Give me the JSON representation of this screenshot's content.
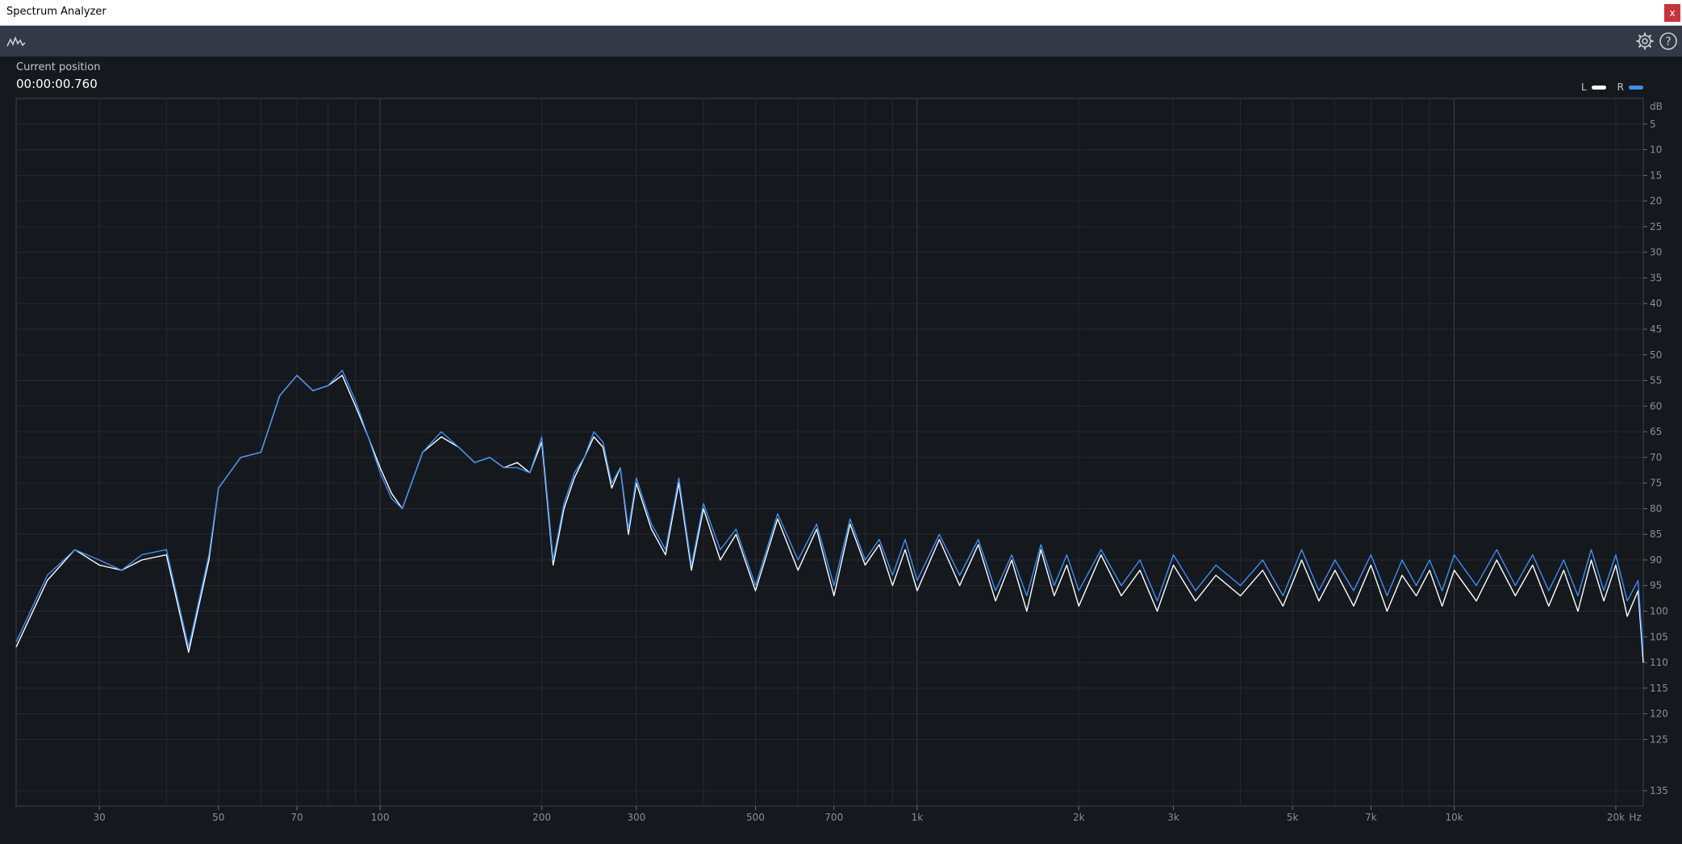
{
  "window": {
    "title": "Spectrum Analyzer",
    "close_label": "x"
  },
  "toolbar": {
    "left_icon": "waveform-icon",
    "gear_icon": "gear-icon",
    "help_icon": "help-icon"
  },
  "status": {
    "position_label": "Current position",
    "position_value": "00:00:00.760"
  },
  "colors": {
    "background": "#15181d",
    "toolbar": "#343a45",
    "grid": "#262b33",
    "major_grid": "#3a3f48",
    "left": "#ffffff",
    "right": "#3e8ef0"
  },
  "chart_data": {
    "type": "line",
    "title": "",
    "xlabel": "Hz",
    "ylabel": "dB",
    "x_scale": "log",
    "xlim": [
      21,
      22500
    ],
    "ylim": [
      0,
      -138
    ],
    "x_ticks": [
      30,
      50,
      70,
      100,
      200,
      300,
      500,
      700,
      1000,
      2000,
      3000,
      5000,
      7000,
      10000,
      20000
    ],
    "x_tick_labels": [
      "30",
      "50",
      "70",
      "100",
      "200",
      "300",
      "500",
      "700",
      "1k",
      "2k",
      "3k",
      "5k",
      "7k",
      "10k",
      "20k"
    ],
    "y_ticks": [
      -5,
      -10,
      -15,
      -20,
      -25,
      -30,
      -35,
      -40,
      -45,
      -50,
      -55,
      -60,
      -65,
      -70,
      -75,
      -80,
      -85,
      -90,
      -95,
      -100,
      -105,
      -110,
      -115,
      -120,
      -125,
      -135
    ],
    "y_tick_labels": [
      "5",
      "10",
      "15",
      "20",
      "25",
      "30",
      "35",
      "40",
      "45",
      "50",
      "55",
      "60",
      "65",
      "70",
      "75",
      "80",
      "85",
      "90",
      "95",
      "100",
      "105",
      "110",
      "115",
      "120",
      "125",
      "135"
    ],
    "grid": true,
    "legend_position": "top-right",
    "series": [
      {
        "name": "L",
        "color": "#ffffff",
        "x": [
          21,
          24,
          27,
          30,
          33,
          36,
          40,
          44,
          48,
          50,
          55,
          60,
          65,
          70,
          75,
          80,
          85,
          90,
          95,
          100,
          105,
          110,
          120,
          130,
          140,
          150,
          160,
          170,
          180,
          190,
          200,
          210,
          220,
          230,
          240,
          250,
          260,
          270,
          280,
          290,
          300,
          320,
          340,
          360,
          380,
          400,
          430,
          460,
          500,
          550,
          600,
          650,
          700,
          750,
          800,
          850,
          900,
          950,
          1000,
          1100,
          1200,
          1300,
          1400,
          1500,
          1600,
          1700,
          1800,
          1900,
          2000,
          2200,
          2400,
          2600,
          2800,
          3000,
          3300,
          3600,
          4000,
          4400,
          4800,
          5200,
          5600,
          6000,
          6500,
          7000,
          7500,
          8000,
          8500,
          9000,
          9500,
          10000,
          11000,
          12000,
          13000,
          14000,
          15000,
          16000,
          17000,
          18000,
          19000,
          20000,
          21000,
          22000,
          22500
        ],
        "y": [
          -107,
          -94,
          -88,
          -91,
          -92,
          -90,
          -89,
          -108,
          -90,
          -76,
          -70,
          -69,
          -58,
          -54,
          -57,
          -56,
          -54,
          -60,
          -66,
          -72,
          -77,
          -80,
          -69,
          -66,
          -68,
          -71,
          -70,
          -72,
          -71,
          -73,
          -67,
          -91,
          -80,
          -74,
          -70,
          -66,
          -68,
          -76,
          -72,
          -85,
          -75,
          -84,
          -89,
          -75,
          -92,
          -80,
          -90,
          -85,
          -96,
          -82,
          -92,
          -84,
          -97,
          -83,
          -91,
          -87,
          -95,
          -88,
          -96,
          -86,
          -95,
          -87,
          -98,
          -90,
          -100,
          -88,
          -97,
          -91,
          -99,
          -89,
          -97,
          -92,
          -100,
          -91,
          -98,
          -93,
          -97,
          -92,
          -99,
          -90,
          -98,
          -92,
          -99,
          -91,
          -100,
          -93,
          -97,
          -92,
          -99,
          -92,
          -98,
          -90,
          -97,
          -91,
          -99,
          -92,
          -100,
          -90,
          -98,
          -91,
          -101,
          -96,
          -110
        ]
      },
      {
        "name": "R",
        "color": "#3e8ef0",
        "x": [
          21,
          24,
          27,
          30,
          33,
          36,
          40,
          44,
          48,
          50,
          55,
          60,
          65,
          70,
          75,
          80,
          85,
          90,
          95,
          100,
          105,
          110,
          120,
          130,
          140,
          150,
          160,
          170,
          180,
          190,
          200,
          210,
          220,
          230,
          240,
          250,
          260,
          270,
          280,
          290,
          300,
          320,
          340,
          360,
          380,
          400,
          430,
          460,
          500,
          550,
          600,
          650,
          700,
          750,
          800,
          850,
          900,
          950,
          1000,
          1100,
          1200,
          1300,
          1400,
          1500,
          1600,
          1700,
          1800,
          1900,
          2000,
          2200,
          2400,
          2600,
          2800,
          3000,
          3300,
          3600,
          4000,
          4400,
          4800,
          5200,
          5600,
          6000,
          6500,
          7000,
          7500,
          8000,
          8500,
          9000,
          9500,
          10000,
          11000,
          12000,
          13000,
          14000,
          15000,
          16000,
          17000,
          18000,
          19000,
          20000,
          21000,
          22000,
          22500
        ],
        "y": [
          -106,
          -93,
          -88,
          -90,
          -92,
          -89,
          -88,
          -107,
          -89,
          -76,
          -70,
          -69,
          -58,
          -54,
          -57,
          -56,
          -53,
          -59,
          -66,
          -73,
          -78,
          -80,
          -69,
          -65,
          -68,
          -71,
          -70,
          -72,
          -72,
          -73,
          -66,
          -90,
          -79,
          -73,
          -70,
          -65,
          -67,
          -75,
          -72,
          -84,
          -74,
          -83,
          -88,
          -74,
          -91,
          -79,
          -88,
          -84,
          -95,
          -81,
          -90,
          -83,
          -95,
          -82,
          -90,
          -86,
          -93,
          -86,
          -94,
          -85,
          -93,
          -86,
          -96,
          -89,
          -97,
          -87,
          -95,
          -89,
          -96,
          -88,
          -95,
          -90,
          -98,
          -89,
          -96,
          -91,
          -95,
          -90,
          -97,
          -88,
          -96,
          -90,
          -96,
          -89,
          -97,
          -90,
          -95,
          -90,
          -96,
          -89,
          -95,
          -88,
          -95,
          -89,
          -96,
          -90,
          -97,
          -88,
          -96,
          -89,
          -98,
          -94,
          -108
        ]
      }
    ]
  }
}
